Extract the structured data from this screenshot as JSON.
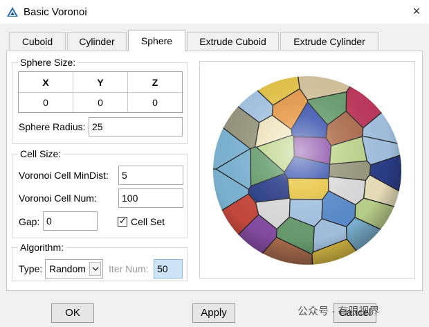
{
  "window": {
    "title": "Basic Voronoi",
    "close_glyph": "×"
  },
  "tabs": [
    {
      "label": "Cuboid"
    },
    {
      "label": "Cylinder"
    },
    {
      "label": "Sphere",
      "active": true
    },
    {
      "label": "Extrude Cuboid"
    },
    {
      "label": "Extrude Cylinder"
    }
  ],
  "sphere_size": {
    "legend": "Sphere Size:",
    "columns": [
      "X",
      "Y",
      "Z"
    ],
    "values": [
      "0",
      "0",
      "0"
    ],
    "radius_label": "Sphere Radius:",
    "radius_value": "25"
  },
  "cell_size": {
    "legend": "Cell Size:",
    "mindist_label": "Voronoi Cell MinDist:",
    "mindist_value": "5",
    "num_label": "Voronoi Cell Num:",
    "num_value": "100",
    "gap_label": "Gap:",
    "gap_value": "0",
    "cellset_label": "Cell Set",
    "cellset_checked": true
  },
  "algorithm": {
    "legend": "Algorithm:",
    "type_label": "Type:",
    "type_value": "Random",
    "iter_label": "Iter Num:",
    "iter_value": "50"
  },
  "buttons": {
    "ok": "OK",
    "apply": "Apply",
    "cancel": "Cancel"
  },
  "watermark": {
    "text": "公众号 · 有限视界"
  },
  "icons": {
    "app": "abaqus-logo-icon",
    "close": "close-icon",
    "check": "checkmark-icon",
    "dropdown": "chevron-down-icon"
  },
  "colors": {
    "accent_input": "#cde4f7",
    "disabled_text": "#9a9a9a"
  }
}
